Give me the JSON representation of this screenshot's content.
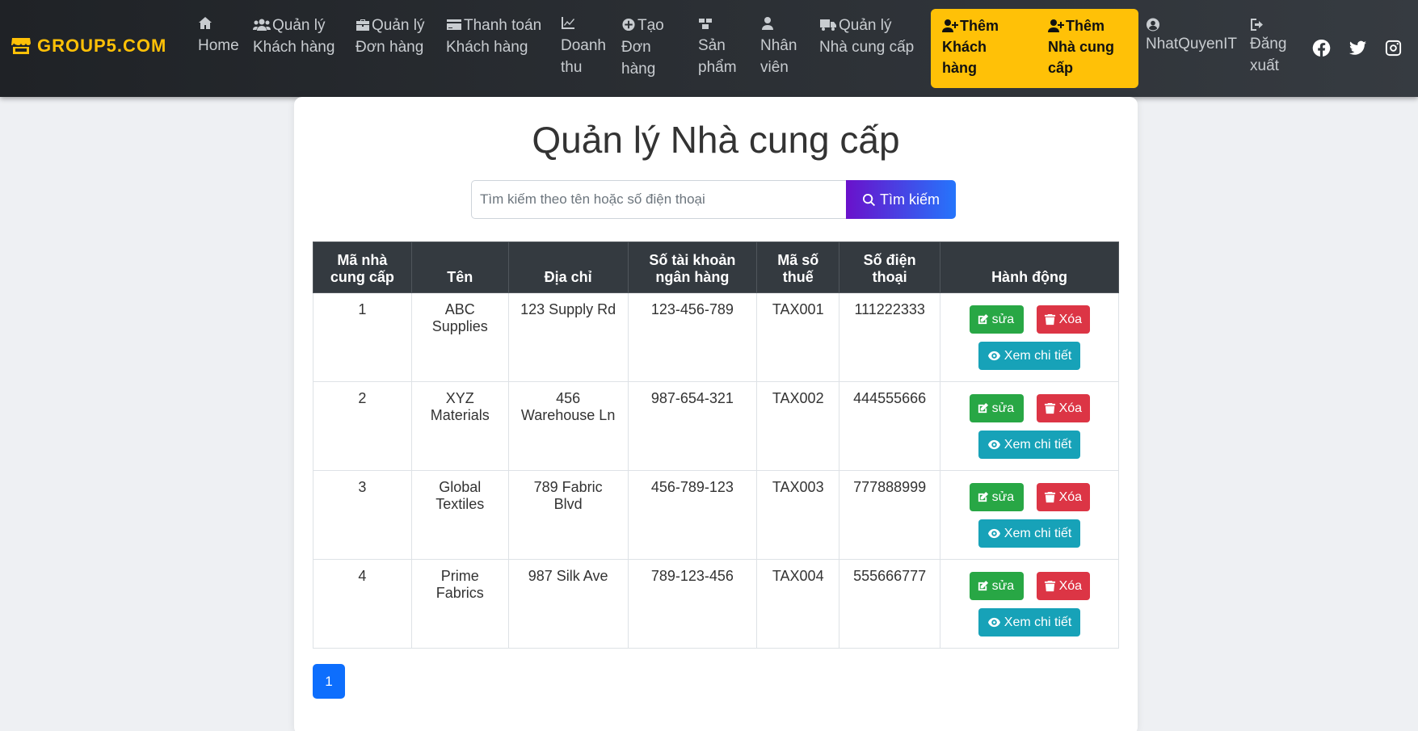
{
  "brand": {
    "name": "GROUP5.COM",
    "icon": "store-icon",
    "color": "#ffc107"
  },
  "nav": {
    "home": {
      "lines": [
        "Home"
      ],
      "icon": "home-icon"
    },
    "customers": {
      "lines": [
        "Quản lý",
        "Khách hàng"
      ],
      "icon": "users-icon"
    },
    "orders": {
      "lines": [
        "Quản lý",
        "Đơn hàng"
      ],
      "icon": "briefcase-icon"
    },
    "payment": {
      "lines": [
        "Thanh toán",
        "Khách hàng"
      ],
      "icon": "credit-card-icon"
    },
    "revenue": {
      "lines": [
        "Doanh",
        "thu"
      ],
      "icon": "chart-line-icon"
    },
    "create_order": {
      "lines": [
        "Tạo",
        "Đơn",
        "hàng"
      ],
      "icon": "plus-circle-icon"
    },
    "products": {
      "lines": [
        "Sản",
        "phẩm"
      ],
      "icon": "boxes-icon"
    },
    "staff": {
      "lines": [
        "Nhân",
        "viên"
      ],
      "icon": "user-tie-icon"
    },
    "suppliers": {
      "lines": [
        "Quản lý",
        "Nhà cung cấp"
      ],
      "icon": "truck-icon"
    },
    "add_customer": {
      "lines": [
        "Thêm",
        "Khách",
        "hàng"
      ],
      "icon": "user-plus-icon"
    },
    "add_supplier": {
      "lines": [
        "Thêm",
        "Nhà cung",
        "cấp"
      ],
      "icon": "user-plus-icon"
    },
    "user": {
      "lines": [
        "NhatQuyenIT"
      ],
      "icon": "user-circle-icon"
    },
    "logout": {
      "lines": [
        "Đăng",
        "xuất"
      ],
      "icon": "sign-out-icon"
    }
  },
  "social": [
    "facebook-icon",
    "twitter-icon",
    "instagram-icon"
  ],
  "page": {
    "title": "Quản lý Nhà cung cấp",
    "search": {
      "placeholder": "Tìm kiếm theo tên hoặc số điện thoại",
      "value": "",
      "button_label": "Tìm kiếm"
    }
  },
  "table": {
    "headers": [
      [
        "Mã nhà",
        "cung cấp"
      ],
      [
        "Tên"
      ],
      [
        "Địa chỉ"
      ],
      [
        "Số tài khoản",
        "ngân hàng"
      ],
      [
        "Mã số",
        "thuế"
      ],
      [
        "Số điện",
        "thoại"
      ],
      [
        "Hành động"
      ]
    ],
    "rows": [
      {
        "id": "1",
        "name": [
          "ABC",
          "Supplies"
        ],
        "address": [
          "123 Supply Rd"
        ],
        "bank": "123-456-789",
        "tax": "TAX001",
        "phone": "111222333"
      },
      {
        "id": "2",
        "name": [
          "XYZ",
          "Materials"
        ],
        "address": [
          "456",
          "Warehouse Ln"
        ],
        "bank": "987-654-321",
        "tax": "TAX002",
        "phone": "444555666"
      },
      {
        "id": "3",
        "name": [
          "Global",
          "Textiles"
        ],
        "address": [
          "789 Fabric",
          "Blvd"
        ],
        "bank": "456-789-123",
        "tax": "TAX003",
        "phone": "777888999"
      },
      {
        "id": "4",
        "name": [
          "Prime",
          "Fabrics"
        ],
        "address": [
          "987 Silk Ave"
        ],
        "bank": "789-123-456",
        "tax": "TAX004",
        "phone": "555666777"
      }
    ],
    "actions": {
      "edit": "sửa",
      "delete": "Xóa",
      "view": "Xem chi tiết"
    }
  },
  "pagination": {
    "current_page": "1"
  },
  "colors": {
    "accent": "#ffc107",
    "edit": "#28a745",
    "delete": "#dc3545",
    "view": "#17a2b8",
    "page": "#0d6efd"
  }
}
